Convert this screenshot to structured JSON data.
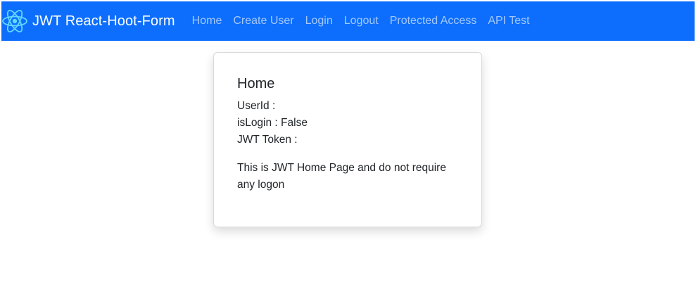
{
  "navbar": {
    "brand": "JWT React-Hoot-Form",
    "logo_icon": "react-atom-icon",
    "links": [
      {
        "label": "Home"
      },
      {
        "label": "Create User"
      },
      {
        "label": "Login"
      },
      {
        "label": "Logout"
      },
      {
        "label": "Protected Access"
      },
      {
        "label": "API Test"
      }
    ],
    "bg_color": "#0d6efd"
  },
  "card": {
    "title": "Home",
    "userid_label": "UserId :",
    "userid_value": "",
    "islogin_label": "isLogin :",
    "islogin_value": "False",
    "jwt_label": "JWT Token :",
    "jwt_value": "",
    "description": "This is JWT Home Page and do not require any logon"
  }
}
